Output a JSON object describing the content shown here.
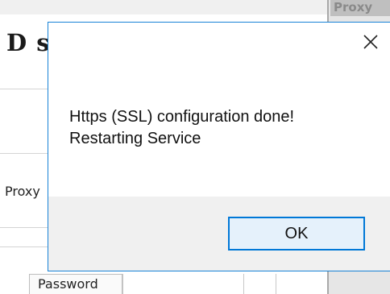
{
  "background_window": {
    "heading": "D s",
    "proxy_label": "Proxy",
    "password_label": "Password"
  },
  "second_window": {
    "tab_label": "Proxy"
  },
  "dialog": {
    "message_line1": "Https (SSL) configuration done!",
    "message_line2": "Restarting Service",
    "ok_label": "OK",
    "close_icon": "close-icon",
    "accent_color": "#0078d7"
  }
}
